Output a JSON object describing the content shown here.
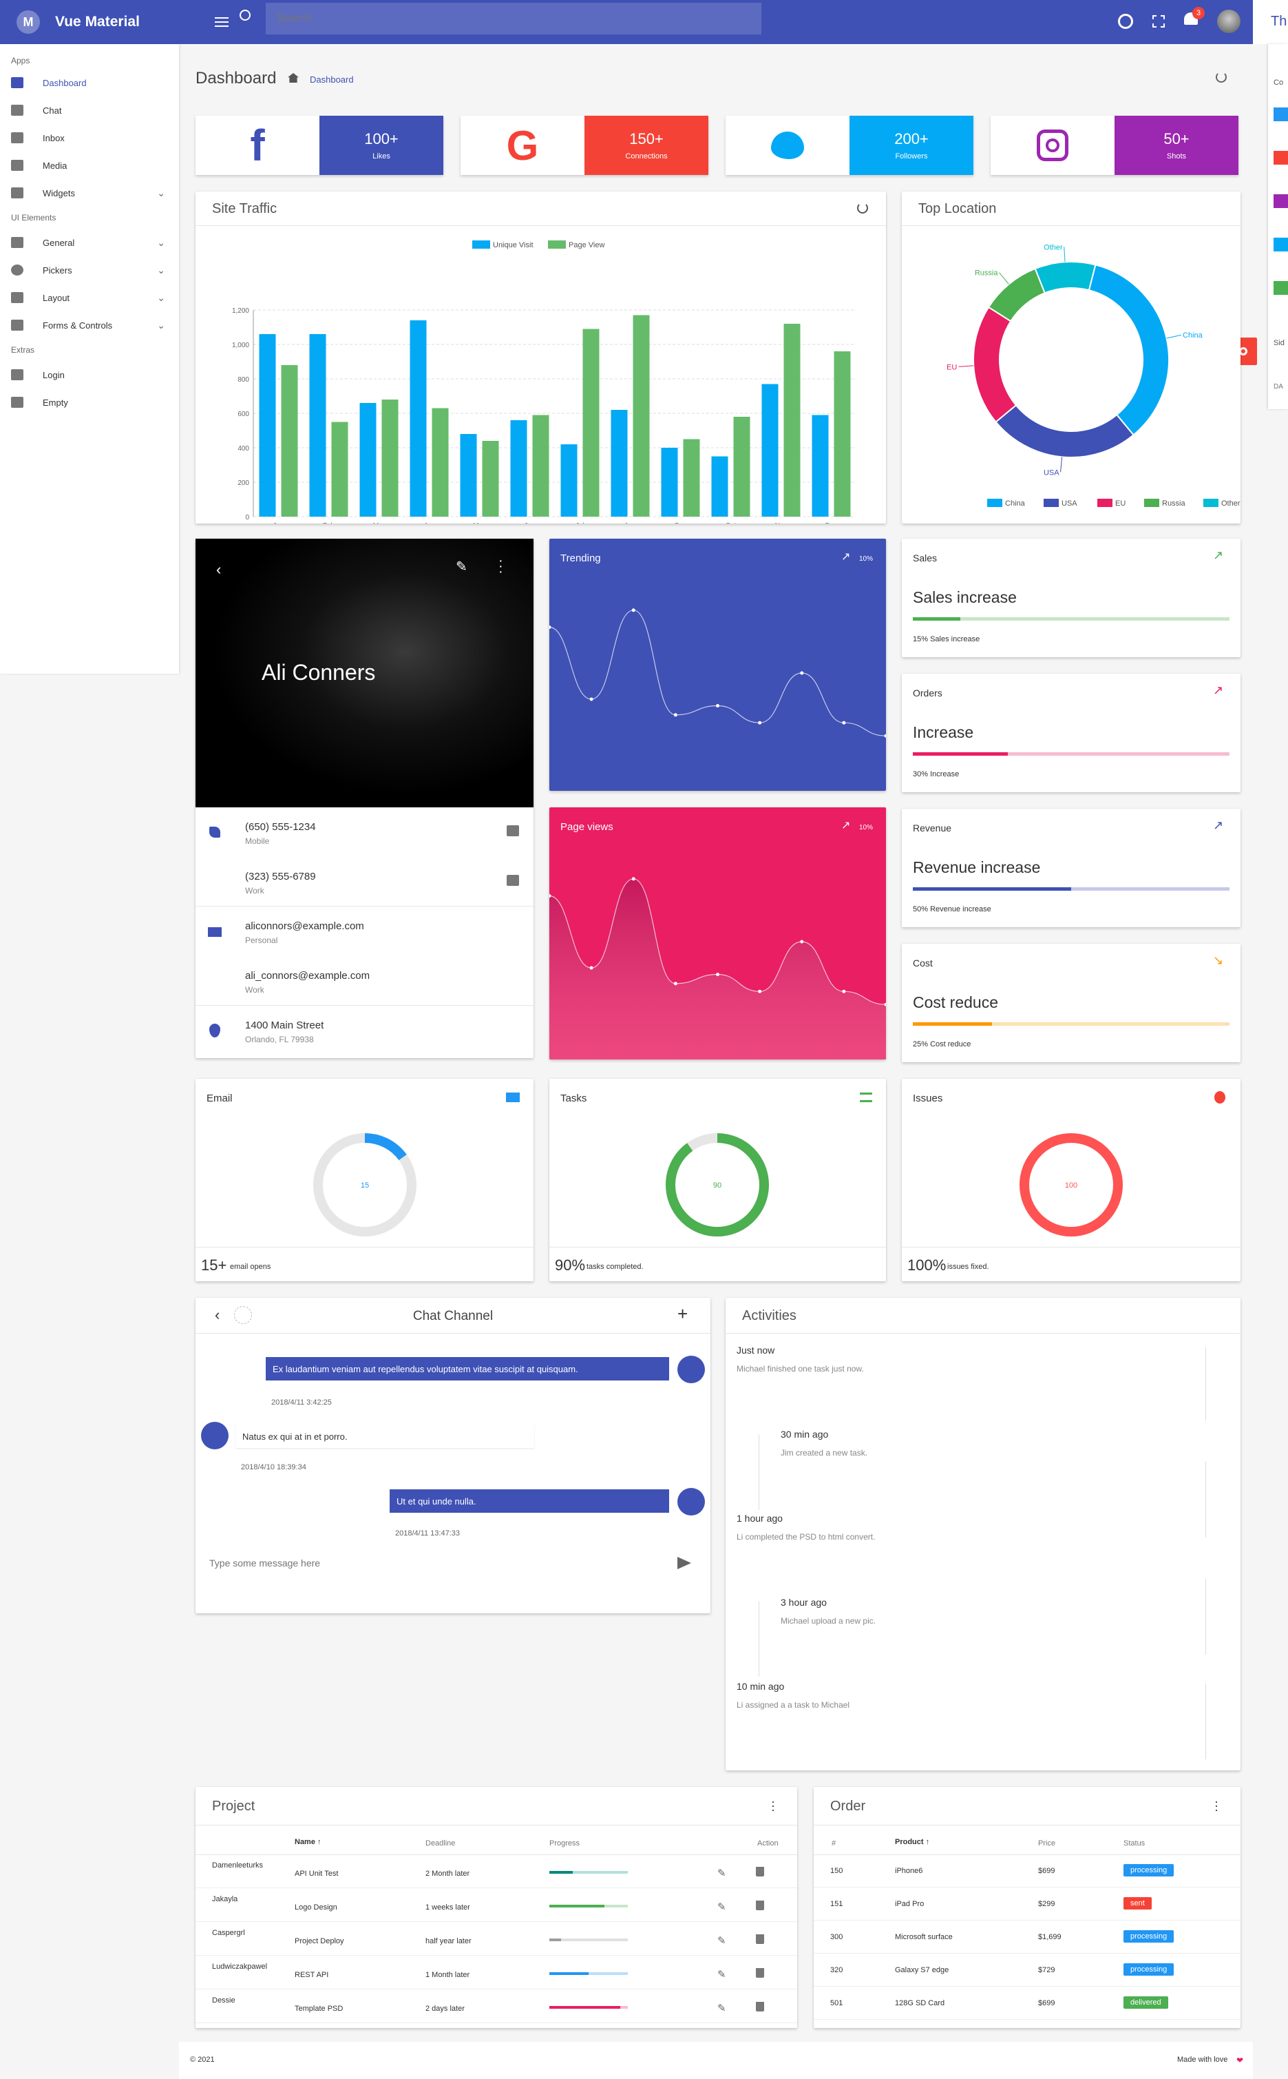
{
  "app": {
    "title": "Vue Material",
    "logo_letter": "M"
  },
  "header": {
    "search_placeholder": "Search",
    "notification_count": "3",
    "right_cut_text": "Th"
  },
  "sidebar": {
    "sections": [
      {
        "label": "Apps"
      },
      {
        "label": "UI Elements"
      },
      {
        "label": "Extras"
      }
    ],
    "items": [
      {
        "label": "Dashboard",
        "icon": "dashboard-icon"
      },
      {
        "label": "Chat",
        "icon": "chat-icon"
      },
      {
        "label": "Inbox",
        "icon": "mail-icon"
      },
      {
        "label": "Media",
        "icon": "photo-library-icon"
      },
      {
        "label": "Widgets",
        "icon": "widgets-icon"
      },
      {
        "label": "General",
        "icon": "tune-icon"
      },
      {
        "label": "Pickers",
        "icon": "settings-icon"
      },
      {
        "label": "Layout",
        "icon": "view-compact-icon"
      },
      {
        "label": "Forms & Controls",
        "icon": "edit-icon"
      },
      {
        "label": "Login",
        "icon": "list-icon"
      },
      {
        "label": "Empty",
        "icon": "file-icon"
      }
    ]
  },
  "page": {
    "title": "Dashboard",
    "breadcrumb": "Dashboard"
  },
  "social": [
    {
      "icon": "facebook-icon",
      "count": "100+",
      "label": "Likes",
      "color": "#3f51b5",
      "icon_color": "#3f51b5"
    },
    {
      "icon": "google-icon",
      "count": "150+",
      "label": "Connections",
      "color": "#f44336",
      "icon_color": "#f44336"
    },
    {
      "icon": "twitter-icon",
      "count": "200+",
      "label": "Followers",
      "color": "#03a9f4",
      "icon_color": "#03a9f4"
    },
    {
      "icon": "instagram-icon",
      "count": "50+",
      "label": "Shots",
      "color": "#9c27b0",
      "icon_color": "#9c27b0"
    }
  ],
  "site_traffic": {
    "title": "Site Traffic",
    "chart_data": {
      "type": "bar",
      "categories": [
        "Jan",
        "Feb",
        "Mar",
        "Apr",
        "May",
        "Jun",
        "Jul",
        "Aug",
        "Sep",
        "Oct",
        "Nov",
        "Dec"
      ],
      "series": [
        {
          "name": "Unique Visit",
          "color": "#03a9f4",
          "values": [
            1060,
            1060,
            660,
            1140,
            480,
            560,
            420,
            620,
            400,
            350,
            770,
            590
          ]
        },
        {
          "name": "Page View",
          "color": "#66bb6a",
          "values": [
            880,
            550,
            680,
            630,
            440,
            590,
            1090,
            1170,
            450,
            580,
            1120,
            960
          ]
        }
      ],
      "ylim": [
        0,
        1200
      ],
      "yticks": [
        "0",
        "200",
        "400",
        "600",
        "800",
        "1,000",
        "1,200"
      ],
      "legend": "top",
      "grid": true
    }
  },
  "top_location": {
    "title": "Top Location",
    "chart_data": {
      "type": "pie",
      "labels": [
        "China",
        "USA",
        "EU",
        "Russia",
        "Other"
      ],
      "values": [
        35,
        25,
        20,
        10,
        10
      ],
      "colors": [
        "#03a9f4",
        "#3f51b5",
        "#e91e63",
        "#4caf50",
        "#00bcd4"
      ]
    }
  },
  "profile": {
    "name": "Ali Conners",
    "contacts": [
      {
        "icon": "phone-icon",
        "value": "(650) 555-1234",
        "type": "Mobile",
        "action": "message-icon"
      },
      {
        "icon": "",
        "value": "(323) 555-6789",
        "type": "Work",
        "action": "message-icon"
      },
      {
        "icon": "email-icon",
        "value": "aliconnors@example.com",
        "type": "Personal",
        "action": ""
      },
      {
        "icon": "",
        "value": "ali_connors@example.com",
        "type": "Work",
        "action": ""
      },
      {
        "icon": "location-icon",
        "value": "1400 Main Street",
        "type": "Orlando, FL 79938",
        "action": ""
      }
    ]
  },
  "trending": {
    "title": "Trending",
    "percent": "10%",
    "color": "#3f51b5",
    "chart_data": {
      "type": "line",
      "values": [
        8.5,
        3.0,
        9.8,
        1.8,
        2.5,
        1.2,
        5.0,
        1.2,
        0.2
      ]
    }
  },
  "page_views": {
    "title": "Page views",
    "percent": "10%",
    "color": "#e91e63",
    "chart_data": {
      "type": "area",
      "values": [
        8.5,
        3.0,
        9.8,
        1.8,
        2.5,
        1.2,
        5.0,
        1.2,
        0.2
      ]
    }
  },
  "kpis": [
    {
      "title": "Sales",
      "headline": "Sales increase",
      "caption": "15% Sales increase",
      "progress": 0.15,
      "color": "#4caf50",
      "bg": "#c8e6c9"
    },
    {
      "title": "Orders",
      "headline": "Increase",
      "caption": "30% Increase",
      "progress": 0.3,
      "color": "#e91e63",
      "bg": "#f8bbd0"
    },
    {
      "title": "Revenue",
      "headline": "Revenue increase",
      "caption": "50% Revenue increase",
      "progress": 0.5,
      "color": "#3f51b5",
      "bg": "#c5cae9"
    },
    {
      "title": "Cost",
      "headline": "Cost reduce",
      "caption": "25% Cost reduce",
      "progress": 0.25,
      "color": "#ff9800",
      "bg": "#ffe0b2"
    }
  ],
  "circles": [
    {
      "title": "Email",
      "value": "15",
      "pct": 0.15,
      "big": "15+",
      "small": "email opens",
      "color": "#2196f3",
      "icon": "email-icon"
    },
    {
      "title": "Tasks",
      "value": "90",
      "pct": 0.9,
      "big": "90%",
      "small": "tasks completed.",
      "color": "#4caf50",
      "icon": "list-icon"
    },
    {
      "title": "Issues",
      "value": "100",
      "pct": 1.0,
      "big": "100%",
      "small": "issues fixed.",
      "color": "#ff5252",
      "icon": "bug-icon"
    }
  ],
  "chat": {
    "title": "Chat Channel",
    "input_placeholder": "Type some message here",
    "messages": [
      {
        "text": "Ex laudantium veniam aut repellendus voluptatem vitae suscipit at quisquam.",
        "time": "2018/4/11 3:42:25",
        "mine": true
      },
      {
        "text": "Natus ex qui at in et porro.",
        "time": "2018/4/10 18:39:34",
        "mine": false
      },
      {
        "text": "Ut et qui unde nulla.",
        "time": "2018/4/11 13:47:33",
        "mine": true
      }
    ]
  },
  "activities": {
    "title": "Activities",
    "items": [
      {
        "time": "Just now",
        "text": "Michael finished one task just now."
      },
      {
        "time": "30 min ago",
        "text": "Jim created a new task."
      },
      {
        "time": "1 hour ago",
        "text": "Li completed the PSD to html convert."
      },
      {
        "time": "3 hour ago",
        "text": "Michael upload a new pic."
      },
      {
        "time": "10 min ago",
        "text": "Li assigned a a task to Michael"
      }
    ]
  },
  "project": {
    "title": "Project",
    "headers": [
      "Name",
      "Deadline",
      "Progress",
      "Action"
    ],
    "rows": [
      {
        "owner": "Damenleeturks",
        "name": "API Unit Test",
        "deadline": "2 Month later",
        "progress": 0.3,
        "color": "#00897b",
        "bg": "#b2dfdb"
      },
      {
        "owner": "Jakayla",
        "name": "Logo Design",
        "deadline": "1 weeks later",
        "progress": 0.7,
        "color": "#4caf50",
        "bg": "#c8e6c9"
      },
      {
        "owner": "Caspergrl",
        "name": "Project Deploy",
        "deadline": "half year later",
        "progress": 0.15,
        "color": "#9e9e9e",
        "bg": "#e0e0e0"
      },
      {
        "owner": "Ludwiczakpawel",
        "name": "REST API",
        "deadline": "1 Month later",
        "progress": 0.5,
        "color": "#2196f3",
        "bg": "#bbdefb"
      },
      {
        "owner": "Dessie",
        "name": "Template PSD",
        "deadline": "2 days later",
        "progress": 0.9,
        "color": "#e91e63",
        "bg": "#f8bbd0"
      }
    ]
  },
  "order": {
    "title": "Order",
    "headers": [
      "#",
      "Product",
      "Price",
      "Status"
    ],
    "rows": [
      {
        "id": "150",
        "product": "iPhone6",
        "price": "$699",
        "status": "processing",
        "color": "#2196f3"
      },
      {
        "id": "151",
        "product": "iPad Pro",
        "price": "$299",
        "status": "sent",
        "color": "#f44336"
      },
      {
        "id": "300",
        "product": "Microsoft surface",
        "price": "$1,699",
        "status": "processing",
        "color": "#2196f3"
      },
      {
        "id": "320",
        "product": "Galaxy S7 edge",
        "price": "$729",
        "status": "processing",
        "color": "#2196f3"
      },
      {
        "id": "501",
        "product": "128G SD Card",
        "price": "$699",
        "status": "delivered",
        "color": "#4caf50"
      }
    ]
  },
  "footer": {
    "copyright": "© 2021",
    "made_with": "Made with love"
  },
  "right_panel": {
    "title": "Th",
    "labels": [
      "Co",
      "Sid",
      "DA"
    ],
    "swatches": [
      "#2196f3",
      "#f44336",
      "#9c27b0",
      "#03a9f4",
      "#4caf50"
    ]
  }
}
